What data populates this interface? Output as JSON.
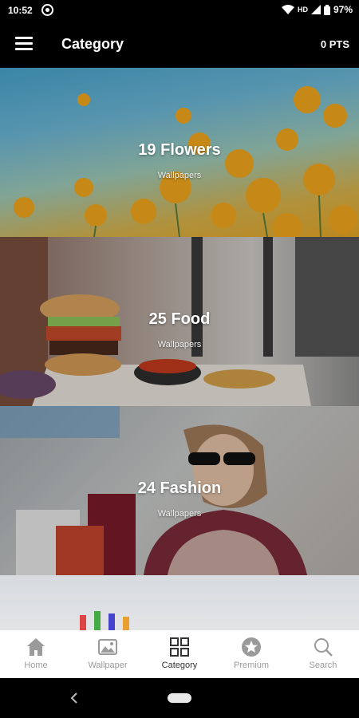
{
  "status_bar": {
    "time": "10:52",
    "network": "HD",
    "battery": "97%"
  },
  "app_bar": {
    "title": "Category",
    "points": "0 PTS"
  },
  "categories": [
    {
      "title": "19 Flowers",
      "subtitle": "Wallpapers"
    },
    {
      "title": "25 Food",
      "subtitle": "Wallpapers"
    },
    {
      "title": "24 Fashion",
      "subtitle": "Wallpapers"
    }
  ],
  "bottom_nav": [
    {
      "label": "Home",
      "icon": "home-icon"
    },
    {
      "label": "Wallpaper",
      "icon": "image-icon"
    },
    {
      "label": "Category",
      "icon": "grid-icon",
      "active": true
    },
    {
      "label": "Premium",
      "icon": "star-badge-icon"
    },
    {
      "label": "Search",
      "icon": "search-icon"
    }
  ],
  "colors": {
    "accent": "#333333",
    "inactive": "#9a9a9a",
    "bar_bg": "#000000"
  }
}
